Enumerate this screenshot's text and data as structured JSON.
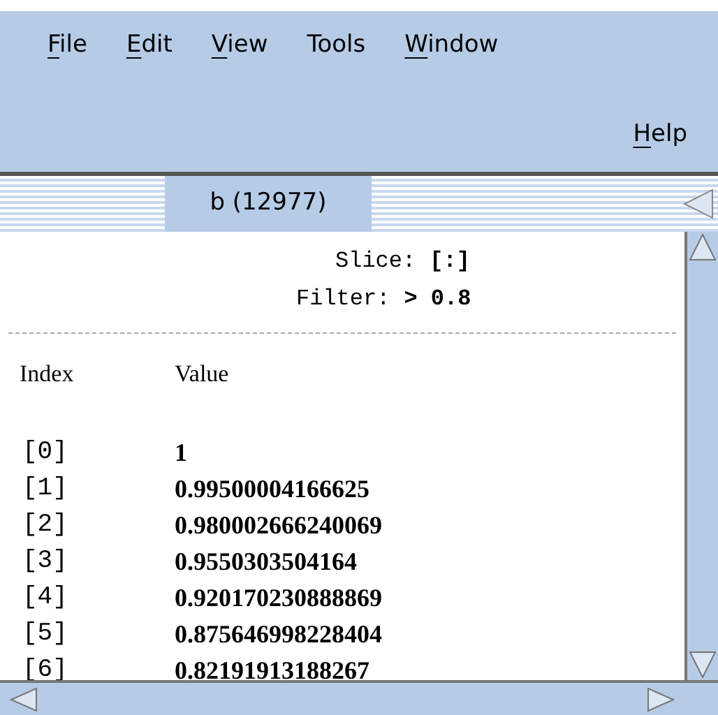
{
  "menu_bar": {
    "items": [
      {
        "label": "File",
        "mnemonic_first": true
      },
      {
        "label": "Edit",
        "mnemonic_first": true
      },
      {
        "label": "View",
        "mnemonic_first": true
      },
      {
        "label": "Tools",
        "mnemonic_first": false
      },
      {
        "label": "Window",
        "mnemonic_first": true
      }
    ],
    "help": {
      "label": "Help",
      "mnemonic_first": true
    }
  },
  "tabs": [
    {
      "label": "b (12977)",
      "selected": true
    }
  ],
  "query": {
    "slice_label": "Slice:",
    "slice_value": "[:]",
    "filter_label": "Filter:",
    "filter_value": "> 0.8"
  },
  "table": {
    "columns": [
      "Index",
      "Value"
    ],
    "rows": [
      {
        "index": "[0]",
        "value": "1"
      },
      {
        "index": "[1]",
        "value": "0.99500004166625"
      },
      {
        "index": "[2]",
        "value": "0.980002666240069"
      },
      {
        "index": "[3]",
        "value": "0.9550303504164"
      },
      {
        "index": "[4]",
        "value": "0.920170230888869"
      },
      {
        "index": "[5]",
        "value": "0.875646998228404"
      },
      {
        "index": "[6]",
        "value": "0.82191913188267"
      }
    ]
  }
}
